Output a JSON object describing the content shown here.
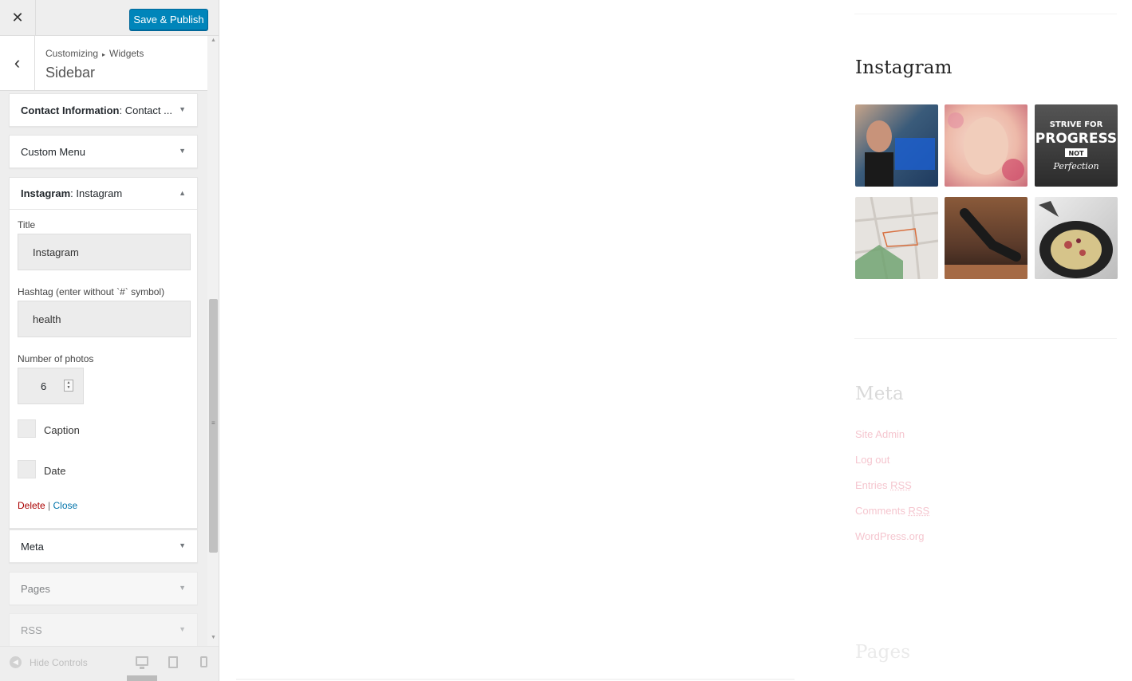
{
  "topbar": {
    "close_icon": "close-icon",
    "publish_label": "Save & Publish",
    "publish_color": "#0085ba"
  },
  "section": {
    "breadcrumb_parent": "Customizing",
    "breadcrumb_child": "Widgets",
    "title": "Sidebar"
  },
  "widgets": {
    "contact": {
      "name": "Contact Information",
      "suffix": ": Contact ..."
    },
    "custom_menu": {
      "name": "Custom Menu"
    },
    "instagram": {
      "name": "Instagram",
      "suffix": ": Instagram",
      "title_label": "Title",
      "title_value": "Instagram",
      "hashtag_label": "Hashtag (enter without `#` symbol)",
      "hashtag_value": "health",
      "photos_label": "Number of photos",
      "photos_value": "6",
      "caption_label": "Caption",
      "date_label": "Date",
      "delete_label": "Delete",
      "separator": "|",
      "close_label": "Close"
    },
    "meta": {
      "name": "Meta"
    },
    "pages": {
      "name": "Pages"
    },
    "rss": {
      "name": "RSS"
    }
  },
  "footer": {
    "hide_controls_label": "Hide Controls"
  },
  "preview": {
    "instagram_heading": "Instagram",
    "instagram_photos": [
      {
        "name": "gym-selfie-photo",
        "colors": [
          "#3a5b7a",
          "#1e3a5f",
          "#c6a48a"
        ]
      },
      {
        "name": "face-mask-photo",
        "colors": [
          "#f2d2c4",
          "#e7a9a1",
          "#c96a78"
        ]
      },
      {
        "name": "strive-for-progress-photo",
        "text": [
          "STRIVE FOR",
          "PROGRESS",
          "NOT",
          "Perfection"
        ],
        "colors": [
          "#2b2b2b",
          "#555555"
        ]
      },
      {
        "name": "running-map-photo",
        "colors": [
          "#e6e3df",
          "#c9c6c2",
          "#6aa06b"
        ]
      },
      {
        "name": "floor-stretch-photo",
        "colors": [
          "#5a3a2a",
          "#8a5a3a",
          "#2b1d17"
        ]
      },
      {
        "name": "oatmeal-bowl-photo",
        "colors": [
          "#2a2a2a",
          "#d6c48a",
          "#b24a4a"
        ]
      }
    ],
    "meta_heading": "Meta",
    "meta_links": [
      {
        "text": "Site Admin",
        "abbr": ""
      },
      {
        "text": "Log out",
        "abbr": ""
      },
      {
        "text": "Entries ",
        "abbr": "RSS"
      },
      {
        "text": "Comments ",
        "abbr": "RSS"
      },
      {
        "text": "WordPress.org",
        "abbr": ""
      }
    ],
    "pages_heading": "Pages"
  }
}
